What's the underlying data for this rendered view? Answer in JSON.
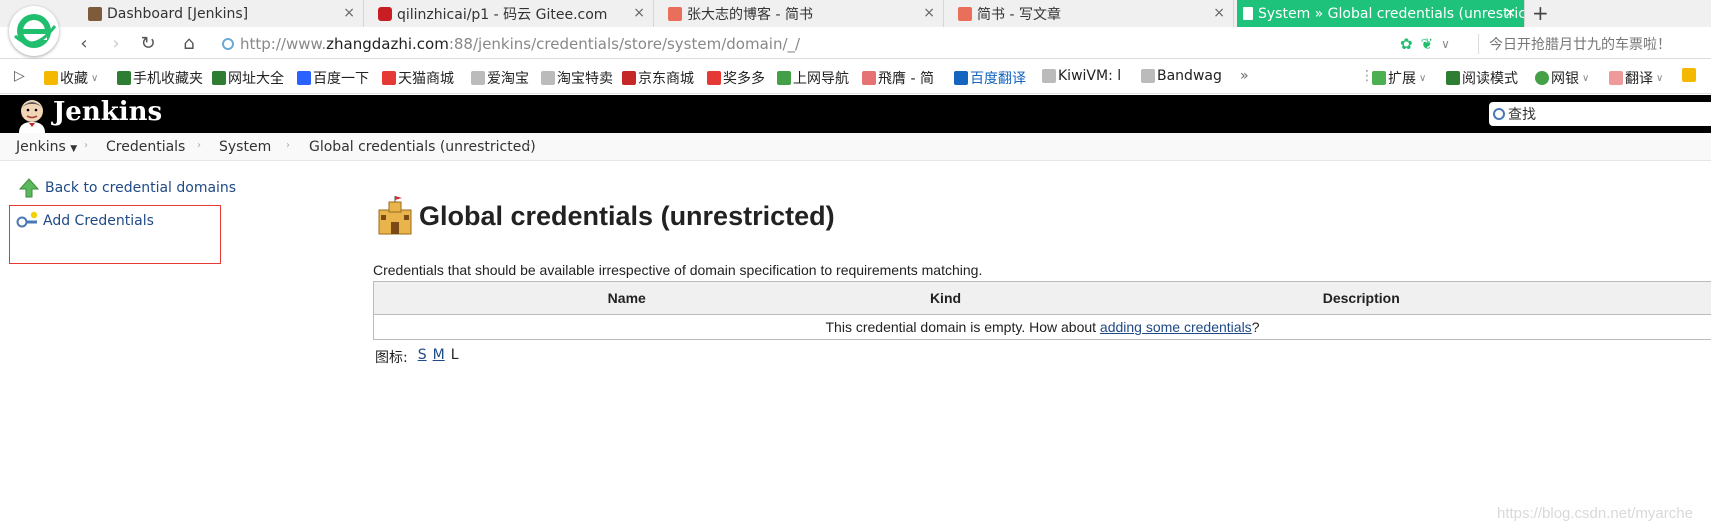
{
  "browser": {
    "tabs": [
      {
        "title": "Dashboard [Jenkins]",
        "close": "×"
      },
      {
        "title": "qilinzhicai/p1 - 码云 Gitee.com",
        "close": "×"
      },
      {
        "title": "张大志的博客 - 简书",
        "close": "×"
      },
      {
        "title": "简书 - 写文章",
        "close": "×"
      },
      {
        "title": "System » Global credentials (unrestricted)",
        "close": "×"
      }
    ],
    "new_tab": "+",
    "url_prefix": "http://www.",
    "url_host": "zhangdazhi.com",
    "url_rest": ":88/jenkins/credentials/store/system/domain/_/",
    "promo_text": "今日开抢腊月廿九的车票啦！",
    "bookmarks": [
      {
        "label": "收藏",
        "color": "#f5b800"
      },
      {
        "label": "手机收藏夹",
        "color": "#2e7d32"
      },
      {
        "label": "网址大全",
        "color": "#2e7d32"
      },
      {
        "label": "百度一下",
        "color": "#2962ff"
      },
      {
        "label": "天猫商城",
        "color": "#e53935"
      },
      {
        "label": "爱淘宝",
        "color": "#bbbbbb"
      },
      {
        "label": "淘宝特卖",
        "color": "#bbbbbb"
      },
      {
        "label": "京东商城",
        "color": "#c62828"
      },
      {
        "label": "奖多多",
        "color": "#e53935"
      },
      {
        "label": "上网导航",
        "color": "#43a047"
      },
      {
        "label": "飛膺 - 简",
        "color": "#e57373"
      },
      {
        "label": "百度翻译",
        "color": "#1565c0"
      },
      {
        "label": "KiwiVM: l",
        "color": "#bbbbbb"
      },
      {
        "label": "Bandwag",
        "color": "#bbbbbb"
      }
    ],
    "bookmarks_more": "»",
    "ext": [
      {
        "label": "扩展"
      },
      {
        "label": "阅读模式"
      },
      {
        "label": "网银"
      },
      {
        "label": "翻译"
      }
    ]
  },
  "jenkins": {
    "title": "Jenkins",
    "search_placeholder": "查找",
    "breadcrumbs": [
      "Jenkins",
      "Credentials",
      "System",
      "Global credentials (unrestricted)"
    ],
    "side": {
      "back": "Back to credential domains",
      "add": "Add Credentials"
    },
    "page_title": "Global credentials (unrestricted)",
    "description": "Credentials that should be available irrespective of domain specification to requirements matching.",
    "table": {
      "headers": [
        "Name",
        "Kind",
        "Description"
      ],
      "empty_prefix": "This credential domain is empty. How about ",
      "empty_link": "adding some credentials",
      "empty_suffix": "?"
    },
    "icon_size": {
      "label": "图标:",
      "s": "S",
      "m": "M",
      "l": "L"
    }
  },
  "watermark": "https://blog.csdn.net/myarche"
}
